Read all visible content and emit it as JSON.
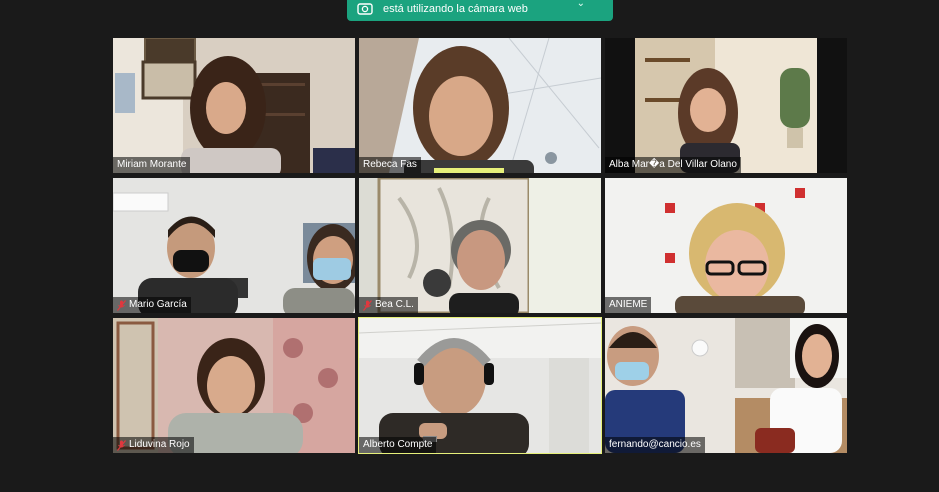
{
  "camera_notice": {
    "text": "está utilizando la cámara web",
    "icon": "webcam-icon",
    "chevron": "chevron-down-icon",
    "color": "#1ba37f"
  },
  "participants": [
    {
      "name": "Miriam Morante",
      "muted": false
    },
    {
      "name": "Rebeca Fas",
      "muted": false
    },
    {
      "name": "Alba Mar�a Del Villar Olano",
      "muted": false
    },
    {
      "name": "Mario García",
      "muted": true
    },
    {
      "name": "Bea C.L.",
      "muted": true
    },
    {
      "name": "ANIEME",
      "muted": false
    },
    {
      "name": "Liduvina Rojo",
      "muted": true
    },
    {
      "name": "Alberto Compte",
      "muted": false,
      "active_speaker": true
    },
    {
      "name": "fernando@cancio.es",
      "muted": false
    }
  ],
  "colors": {
    "background": "#1a1a1a",
    "active_speaker_border": "#e6f07a",
    "mute_icon": "#e0383e"
  }
}
